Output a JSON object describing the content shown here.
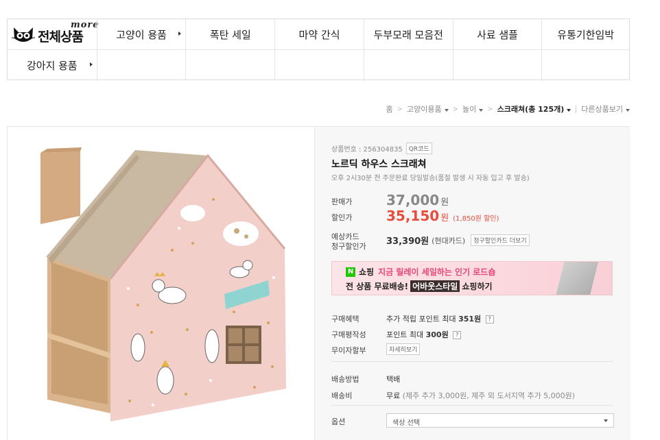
{
  "nav": {
    "logo_more": "more",
    "logo_text": "전체상품",
    "row1": [
      "고양이 용품",
      "폭탄 세일",
      "마약 간식",
      "두부모래 모음전",
      "사료 샘플",
      "유통기한임박"
    ],
    "row2": [
      "강아지 용품"
    ]
  },
  "breadcrumb": {
    "home": "홈",
    "cat1": "고양이용품",
    "cat2": "놀이",
    "current": "스크래쳐(총 125개)",
    "other": "다른상품보기"
  },
  "product": {
    "number_label": "상품번호 : 256304835",
    "qr_label": "QR코드",
    "name": "노르딕 하우스 스크래쳐",
    "shipping_note": "오후 2시30분 전 주문완료 당일발송(품절 발생 시 자동 입고 후 발송)",
    "price_label": "판매가",
    "price": "37,000",
    "won": "원",
    "sale_label": "할인가",
    "sale_price": "35,150",
    "sale_discount": "(1,850원 할인)",
    "card_label_1": "예상카드",
    "card_label_2": "청구할인가",
    "card_price": "33,390원",
    "card_name": "(현대카드)",
    "card_btn": "청구할인카드 더보기"
  },
  "banner": {
    "n_logo": "N",
    "shop": "쇼핑",
    "line1_pink": "지금 릴레이 세일하는 인기 로드숍",
    "line2_start": "전 상품 무료배송!",
    "line2_tag": "어바웃스타일",
    "line2_end": "쇼핑하기"
  },
  "benefits": {
    "buy_label": "구매혜택",
    "buy_value_prefix": "추가 적립 포인트 최대",
    "buy_value_amount": "351원",
    "review_label": "구매평작성",
    "review_value_prefix": "포인트 최대",
    "review_value_amount": "300원",
    "installment_label": "무이자할부",
    "installment_btn": "자세히보기",
    "qmark": "?"
  },
  "delivery": {
    "method_label": "배송방법",
    "method_value": "택배",
    "fee_label": "배송비",
    "fee_value": "무료",
    "fee_note": "(제주 추가 3,000원, 제주 외 도서지역 추가 5,000원)"
  },
  "option": {
    "label": "옵션",
    "placeholder": "색상 선택"
  },
  "colors": {
    "sale_red": "#e84c3c",
    "naver_green": "#1ec800",
    "banner_pink": "#fbd9de"
  }
}
